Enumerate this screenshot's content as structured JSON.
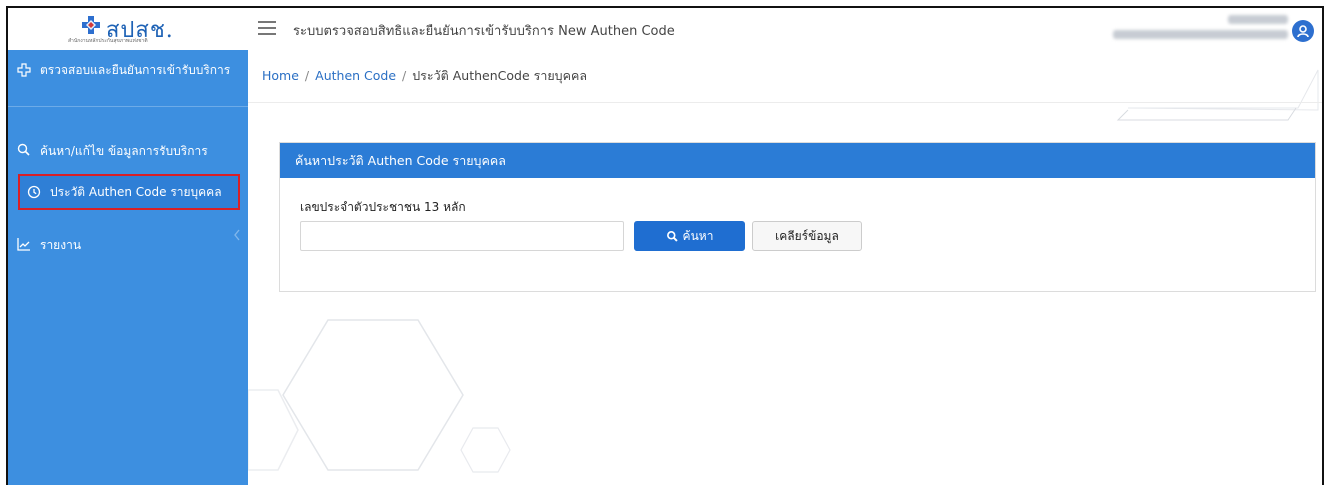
{
  "brand": {
    "logo_text": "สปสช.",
    "logo_subtext": "สำนักงานหลักประกันสุขภาพแห่งชาติ"
  },
  "header": {
    "title": "ระบบตรวจสอบสิทธิและยืนยันการเข้ารับบริการ New Authen Code"
  },
  "sidebar": {
    "items": [
      {
        "label": "ตรวจสอบและยืนยันการเข้ารับบริการ",
        "icon": "plus-cross-icon"
      },
      {
        "label": "ค้นหา/แก้ไข ข้อมูลการรับบริการ",
        "icon": "search-icon"
      },
      {
        "label": "ประวัติ Authen Code รายบุคคล",
        "icon": "history-icon",
        "active": true
      },
      {
        "label": "รายงาน",
        "icon": "chart-line-icon"
      }
    ]
  },
  "breadcrumb": {
    "home": "Home",
    "level1": "Authen Code",
    "current": "ประวัติ AuthenCode รายบุคคล"
  },
  "card": {
    "title": "ค้นหาประวัติ Authen Code รายบุคคล",
    "field_label": "เลขประจำตัวประชาชน 13 หลัก",
    "input_value": "",
    "search_label": "ค้นหา",
    "clear_label": "เคลียร์ข้อมูล"
  },
  "colors": {
    "primary": "#2b7cd6",
    "sidebar": "#3d8fe0",
    "highlight": "#d91f26"
  }
}
